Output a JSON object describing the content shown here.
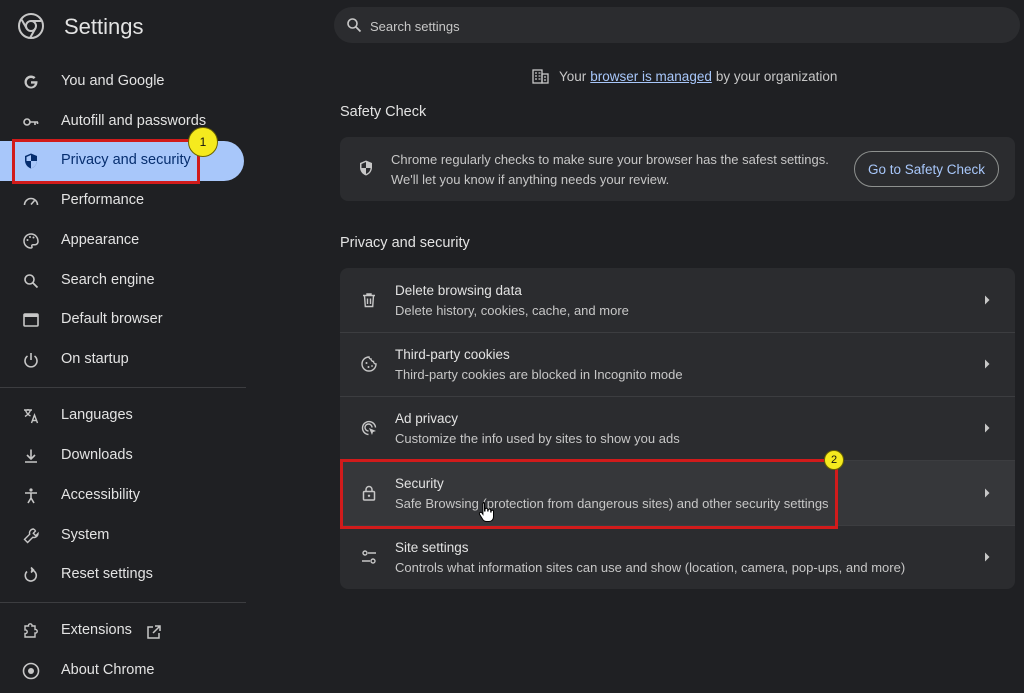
{
  "app": {
    "title": "Settings"
  },
  "search": {
    "placeholder": "Search settings"
  },
  "managed": {
    "prefix": "Your",
    "link": "browser is managed",
    "suffix": "by your organization"
  },
  "sidebar": {
    "items": [
      {
        "label": "You and Google",
        "icon": "google-icon"
      },
      {
        "label": "Autofill and passwords",
        "icon": "key-icon"
      },
      {
        "label": "Privacy and security",
        "icon": "shield-icon",
        "active": true
      },
      {
        "label": "Performance",
        "icon": "speedometer-icon"
      },
      {
        "label": "Appearance",
        "icon": "palette-icon"
      },
      {
        "label": "Search engine",
        "icon": "search-icon"
      },
      {
        "label": "Default browser",
        "icon": "browser-window-icon"
      },
      {
        "label": "On startup",
        "icon": "power-icon"
      },
      {
        "label": "Languages",
        "icon": "translate-icon"
      },
      {
        "label": "Downloads",
        "icon": "download-icon"
      },
      {
        "label": "Accessibility",
        "icon": "accessibility-icon"
      },
      {
        "label": "System",
        "icon": "wrench-icon"
      },
      {
        "label": "Reset settings",
        "icon": "reset-icon"
      },
      {
        "label": "Extensions",
        "icon": "puzzle-icon"
      },
      {
        "label": "About Chrome",
        "icon": "chrome-icon"
      }
    ]
  },
  "safety_check": {
    "title": "Safety Check",
    "line1": "Chrome regularly checks to make sure your browser has the safest settings.",
    "line2": "We'll let you know if anything needs your review.",
    "button": "Go to Safety Check"
  },
  "privacy_section": {
    "title": "Privacy and security",
    "rows": [
      {
        "title": "Delete browsing data",
        "subtitle": "Delete history, cookies, cache, and more",
        "icon": "trash-icon"
      },
      {
        "title": "Third-party cookies",
        "subtitle": "Third-party cookies are blocked in Incognito mode",
        "icon": "cookie-icon"
      },
      {
        "title": "Ad privacy",
        "subtitle": "Customize the info used by sites to show you ads",
        "icon": "ad-privacy-icon"
      },
      {
        "title": "Security",
        "subtitle": "Safe Browsing (protection from dangerous sites) and other security settings",
        "icon": "lock-icon"
      },
      {
        "title": "Site settings",
        "subtitle": "Controls what information sites can use and show (location, camera, pop-ups, and more)",
        "icon": "sliders-icon"
      }
    ]
  },
  "annotations": {
    "badge1": "1",
    "badge2": "2"
  },
  "colors": {
    "accent": "#a8c7fa",
    "active_text": "#062e6f",
    "highlight": "#d11b1b",
    "badge": "#f5ea1e"
  }
}
